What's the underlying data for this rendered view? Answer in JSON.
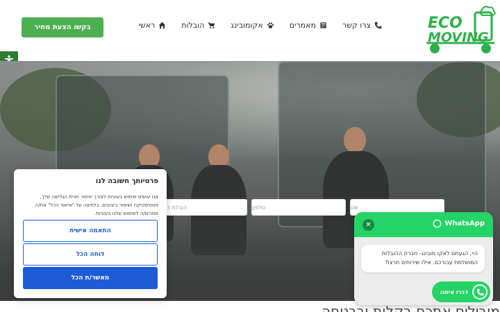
{
  "header": {
    "cta_label": "בקשו הצעת מחיר",
    "nav": [
      {
        "label": "ראשי",
        "icon": "home-icon"
      },
      {
        "label": "הובלות",
        "icon": "cart-icon"
      },
      {
        "label": "אקומובינג",
        "icon": "paw-icon"
      },
      {
        "label": "מאמרים",
        "icon": "article-icon"
      },
      {
        "label": "צרו קשר",
        "icon": "phone-icon"
      }
    ],
    "logo": {
      "line1": "ECO",
      "line2": "MOVING"
    }
  },
  "form": {
    "name_placeholder": "שם",
    "phone_placeholder": "טלפון",
    "apartment_placeholder": "הובלת דירה"
  },
  "hero_title_partial": "מובילים אתכם בקלות ובבטחה",
  "cookie": {
    "title": "פרטיותך חשובה לנו",
    "text": "אנו עושים שימוש בעוגיות לצורך שיפור חווית הגלישה שלך, סטטיסטיקה ושיפור ביצועים. בלחיצה על \"אישור הכל\" את/ה מסכים/ה לשימוש שלנו בעוגיות.",
    "customize_label": "התאמה אישית",
    "reject_label": "דוחה הכל",
    "accept_label": "מאשר/ת הכל"
  },
  "whatsapp": {
    "brand": "WhatsApp",
    "message": "היי, הגעתם לאקו מובינג- חברת ההובלות המושלמת עבורכם. אילו שירותים תרצו?",
    "action_label": "דברו איתנו"
  },
  "colors": {
    "brand_green": "#4caf50",
    "logo_green": "#2db04b",
    "whatsapp_green": "#25d366",
    "cookie_blue": "#1e5bd6"
  }
}
